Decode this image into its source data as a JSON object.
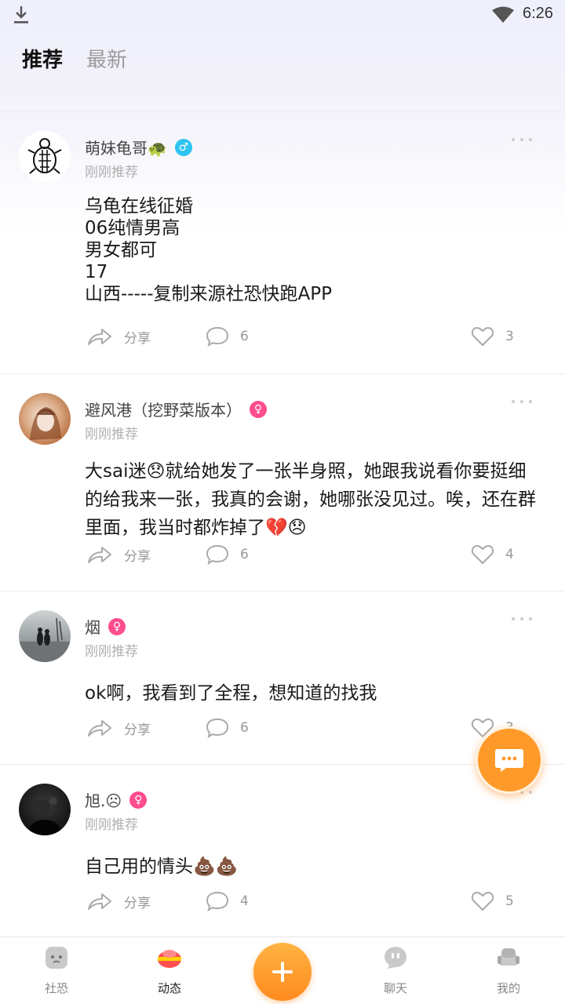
{
  "status_bar": {
    "time": "6:26"
  },
  "tabs": [
    {
      "label": "推荐",
      "active": true
    },
    {
      "label": "最新",
      "active": false
    }
  ],
  "posts": [
    {
      "author": "萌妹龟哥",
      "author_emoji": "🐢",
      "gender": "male",
      "time": "刚刚推荐",
      "content": "乌龟在线征婚\n06纯情男高\n男女都可\n17\n山西-----复制来源社恐快跑APP",
      "share_label": "分享",
      "comments": "6",
      "likes": "3"
    },
    {
      "author": "避风港（挖野菜版本）",
      "author_emoji": "",
      "gender": "female",
      "time": "刚刚推荐",
      "content": "大sai迷😞就给她发了一张半身照，她跟我说看你要挺细的给我来一张，我真的会谢，她哪张没见过。唉，还在群里面，我当时都炸掉了💔😞",
      "share_label": "分享",
      "comments": "6",
      "likes": "4"
    },
    {
      "author": "烟",
      "author_emoji": "",
      "gender": "female",
      "time": "刚刚推荐",
      "content": "ok啊，我看到了全程，想知道的找我",
      "share_label": "分享",
      "comments": "6",
      "likes": "3"
    },
    {
      "author": "旭.☹",
      "author_emoji": "",
      "gender": "female",
      "time": "刚刚推荐",
      "content": "自己用的情头💩💩",
      "share_label": "分享",
      "comments": "4",
      "likes": "5"
    }
  ],
  "bottom_nav": [
    {
      "label": "社恐",
      "icon": "shekong-icon",
      "active": false
    },
    {
      "label": "动态",
      "icon": "dongtai-icon",
      "active": true
    },
    {
      "label": "",
      "icon": "plus-icon",
      "active": false
    },
    {
      "label": "聊天",
      "icon": "chat-icon",
      "active": false
    },
    {
      "label": "我的",
      "icon": "profile-icon",
      "active": false
    }
  ],
  "colors": {
    "accent": "#ff9a2a",
    "male": "#2ec3f0",
    "female": "#ff4d8d"
  }
}
